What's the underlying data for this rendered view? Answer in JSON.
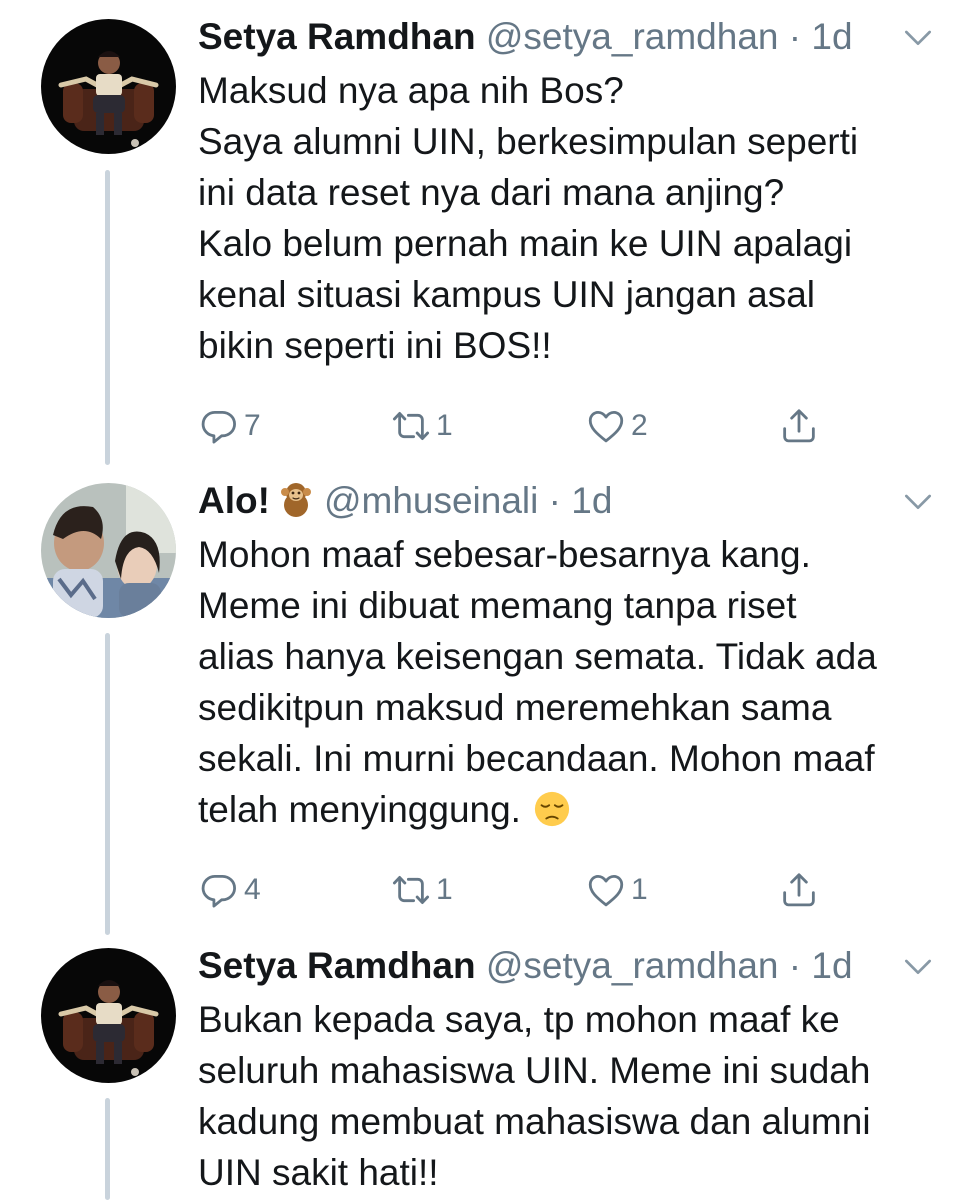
{
  "tweets": [
    {
      "name": "Setya Ramdhan",
      "handle": "@setya_ramdhan",
      "separator": "·",
      "time": "1d",
      "lines": [
        "Maksud nya apa nih Bos?",
        "Saya alumni UIN, berkesimpulan seperti",
        "ini data reset nya dari mana anjing?",
        "Kalo belum pernah main ke UIN apalagi",
        "kenal situasi kampus UIN jangan asal",
        "bikin seperti ini BOS!!"
      ],
      "replies": "7",
      "retweets": "1",
      "likes": "2",
      "icons": [
        "reply-icon",
        "retweet-icon",
        "like-icon",
        "share-icon",
        "chevron-down-icon"
      ]
    },
    {
      "name": "Alo!",
      "name_emoji": "monkey-emoji",
      "handle": "@mhuseinali",
      "separator": "·",
      "time": "1d",
      "lines": [
        "Mohon maaf sebesar-besarnya kang.",
        "Meme ini dibuat memang tanpa riset",
        "alias hanya keisengan semata. Tidak ada",
        "sedikitpun maksud meremehkan sama",
        "sekali. Ini murni becandaan. Mohon maaf",
        "telah menyinggung."
      ],
      "trailing_emoji": "pensive-face-emoji",
      "replies": "4",
      "retweets": "1",
      "likes": "1",
      "icons": [
        "reply-icon",
        "retweet-icon",
        "like-icon",
        "share-icon",
        "chevron-down-icon"
      ]
    },
    {
      "name": "Setya Ramdhan",
      "handle": "@setya_ramdhan",
      "separator": "·",
      "time": "1d",
      "lines": [
        "Bukan kepada saya, tp mohon maaf ke",
        "seluruh mahasiswa UIN. Meme ini sudah",
        "kadung membuat mahasiswa dan alumni",
        "UIN sakit hati!!"
      ],
      "icons": [
        "chevron-down-icon"
      ]
    }
  ],
  "colors": {
    "text": "#14171a",
    "secondary": "#657786",
    "thread_line": "#c9d3dc",
    "background": "#ffffff"
  }
}
